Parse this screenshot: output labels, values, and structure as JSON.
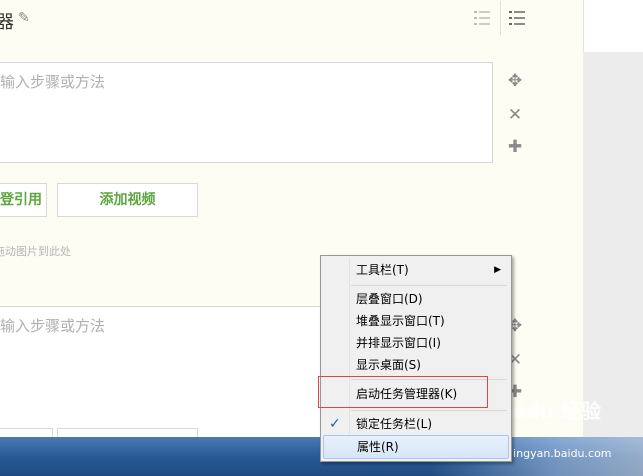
{
  "header": {
    "title_fragment": "器"
  },
  "steps": [
    {
      "placeholder": "输入步骤或方法"
    },
    {
      "placeholder": "输入步骤或方法"
    }
  ],
  "buttons": {
    "quote_fragment": "登引用",
    "add_video": "添加视频"
  },
  "hint": "拖动图片到此处",
  "context_menu": {
    "toolbars": "工具栏(T)",
    "cascade": "层叠窗口(D)",
    "stacked": "堆叠显示窗口(T)",
    "side_by_side": "并排显示窗口(I)",
    "show_desktop": "显示桌面(S)",
    "task_manager": "启动任务管理器(K)",
    "lock_taskbar": "锁定任务栏(L)",
    "properties": "属性(R)"
  },
  "watermark": {
    "brand": "Baidu 经验",
    "url": "jingyan.baidu.com"
  },
  "colors": {
    "accent_green": "#5da53f",
    "highlight_red": "#e04545",
    "taskbar_blue": "#2a5a94"
  }
}
